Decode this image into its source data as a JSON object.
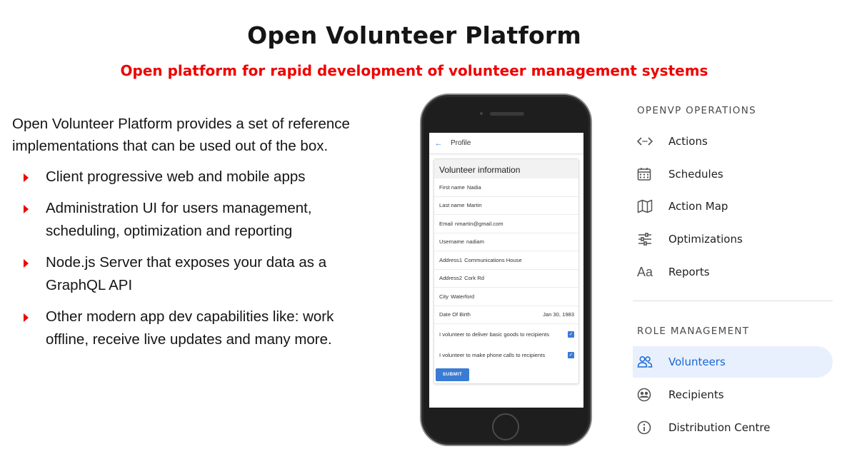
{
  "header": {
    "title": "Open Volunteer Platform",
    "subtitle": "Open platform for rapid development of volunteer management systems"
  },
  "intro": "Open Volunteer Platform provides a set of reference implementations that can be used out of the box.",
  "bullets": [
    "Client progressive web and mobile apps",
    "Administration UI for users management, scheduling, optimization and reporting",
    "Node.js Server that exposes your data as a GraphQL API",
    "Other modern app dev capabilities like: work offline, receive live updates and many more."
  ],
  "colors": {
    "accent_red": "#ee0000",
    "link_blue": "#3a7bd5",
    "active_bg": "#e8f0fe",
    "active_text": "#1967d2"
  },
  "phone": {
    "screen_title": "Profile",
    "back_icon": "arrow-left-icon",
    "card_title": "Volunteer information",
    "fields": [
      {
        "label": "First name",
        "value": "Nadia"
      },
      {
        "label": "Last name",
        "value": "Martin"
      },
      {
        "label": "Email",
        "value": "nmartin@gmail.com"
      },
      {
        "label": "Username",
        "value": "nadiam"
      },
      {
        "label": "Address1",
        "value": "Communications House"
      },
      {
        "label": "Address2",
        "value": "Cork Rd"
      },
      {
        "label": "City",
        "value": "Waterford"
      }
    ],
    "date_of_birth": {
      "label": "Date Of Birth",
      "value": "Jan 30, 1983"
    },
    "checkboxes": [
      {
        "label": "I volunteer to deliver basic goods to recipients",
        "checked": true
      },
      {
        "label": "I volunteer to make phone calls to recipients",
        "checked": true
      }
    ],
    "submit_label": "SUBMIT"
  },
  "sidebar": {
    "operations_title": "OPENVP OPERATIONS",
    "operations": [
      {
        "label": "Actions",
        "icon": "code-arrows-icon"
      },
      {
        "label": "Schedules",
        "icon": "calendar-icon"
      },
      {
        "label": "Action Map",
        "icon": "map-icon"
      },
      {
        "label": "Optimizations",
        "icon": "sliders-icon"
      },
      {
        "label": "Reports",
        "icon": "font-icon",
        "icon_text": "Aa"
      }
    ],
    "roles_title": "ROLE MANAGEMENT",
    "roles": [
      {
        "label": "Volunteers",
        "icon": "people-icon",
        "active": true
      },
      {
        "label": "Recipients",
        "icon": "group-circle-icon"
      },
      {
        "label": "Distribution Centre",
        "icon": "info-icon"
      }
    ]
  }
}
